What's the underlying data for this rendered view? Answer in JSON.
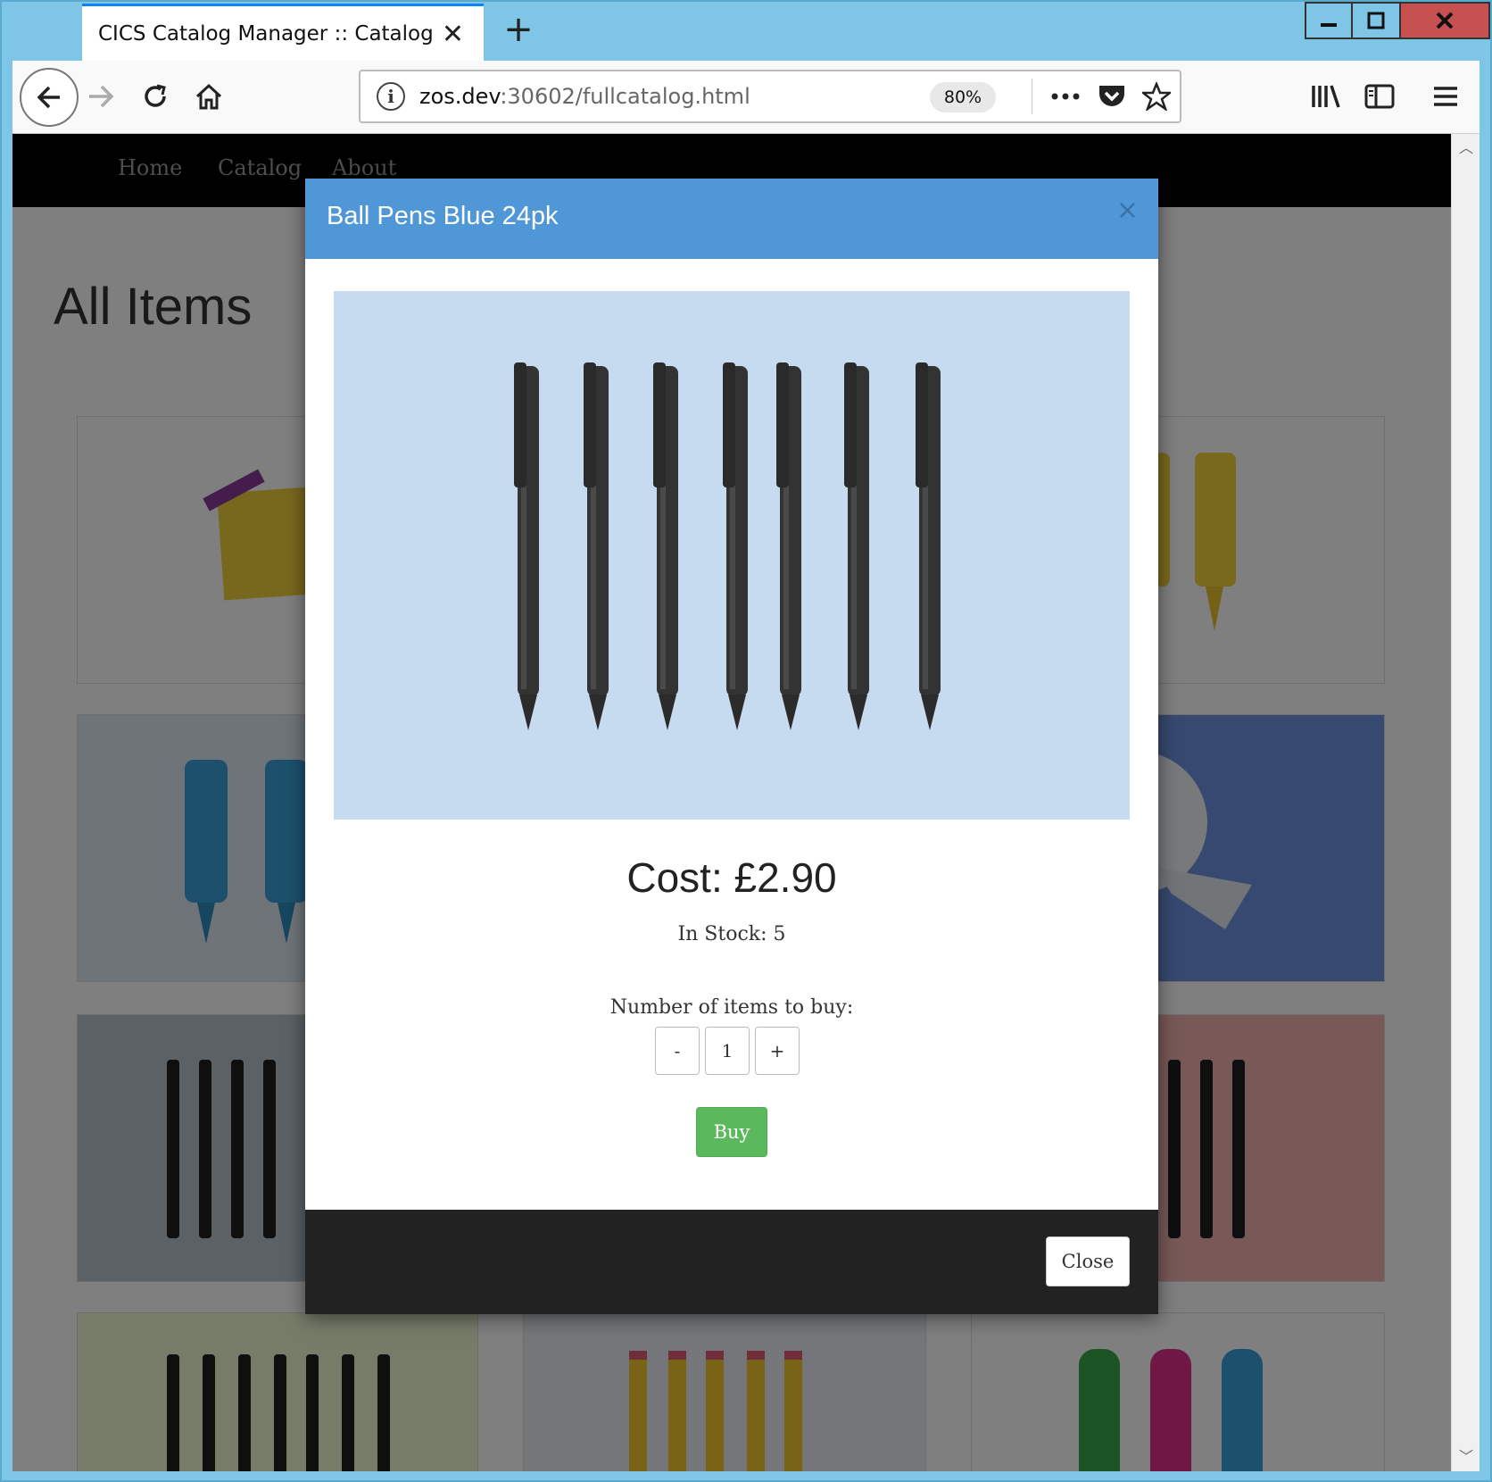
{
  "browser": {
    "tab_title": "CICS Catalog Manager :: Catalog",
    "url_host": "zos.dev",
    "url_path": ":30602/fullcatalog.html",
    "zoom": "80%"
  },
  "site": {
    "nav": [
      "Home",
      "Catalog",
      "About"
    ],
    "heading": "All Items"
  },
  "modal": {
    "title": "Ball Pens Blue 24pk",
    "cost": "Cost: £2.90",
    "stock": "In Stock: 5",
    "qty_label": "Number of items to buy:",
    "qty_minus": "-",
    "qty_value": "1",
    "qty_plus": "+",
    "buy": "Buy",
    "close": "Close",
    "close_x": "×"
  },
  "colors": {
    "modal_header": "#4f97d6",
    "buy_button": "#5cb85c",
    "image_bg": "#c6daf0"
  }
}
